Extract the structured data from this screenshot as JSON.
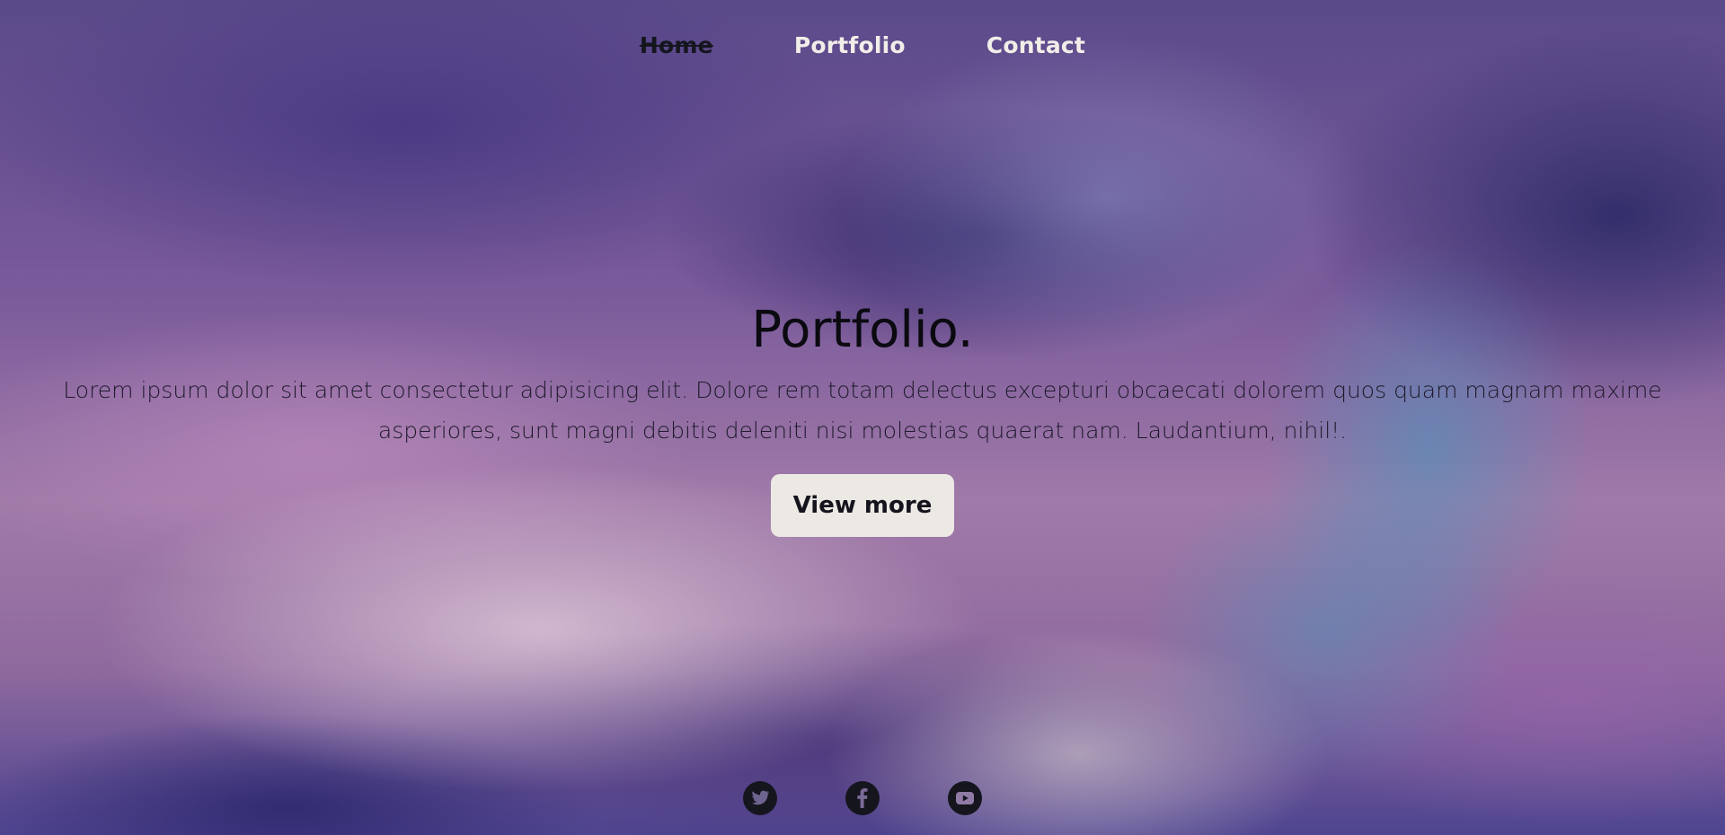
{
  "nav": {
    "items": [
      {
        "label": "Home",
        "active": true
      },
      {
        "label": "Portfolio",
        "active": false
      },
      {
        "label": "Contact",
        "active": false
      }
    ]
  },
  "hero": {
    "title": "Portfolio.",
    "description": "Lorem ipsum dolor sit amet consectetur adipisicing elit. Dolore rem totam delectus excepturi obcaecati dolorem quos quam magnam maxime asperiores, sunt magni debitis deleniti nisi molestias quaerat nam. Laudantium, nihil!.",
    "button_label": "View more"
  },
  "social": {
    "icons": [
      "twitter-icon",
      "facebook-icon",
      "youtube-icon"
    ]
  },
  "colors": {
    "accent_button_bg": "#ece8e4",
    "nav_text": "#f1eee9",
    "nav_active_text": "#15151e",
    "icon_fill": "#15151e"
  }
}
